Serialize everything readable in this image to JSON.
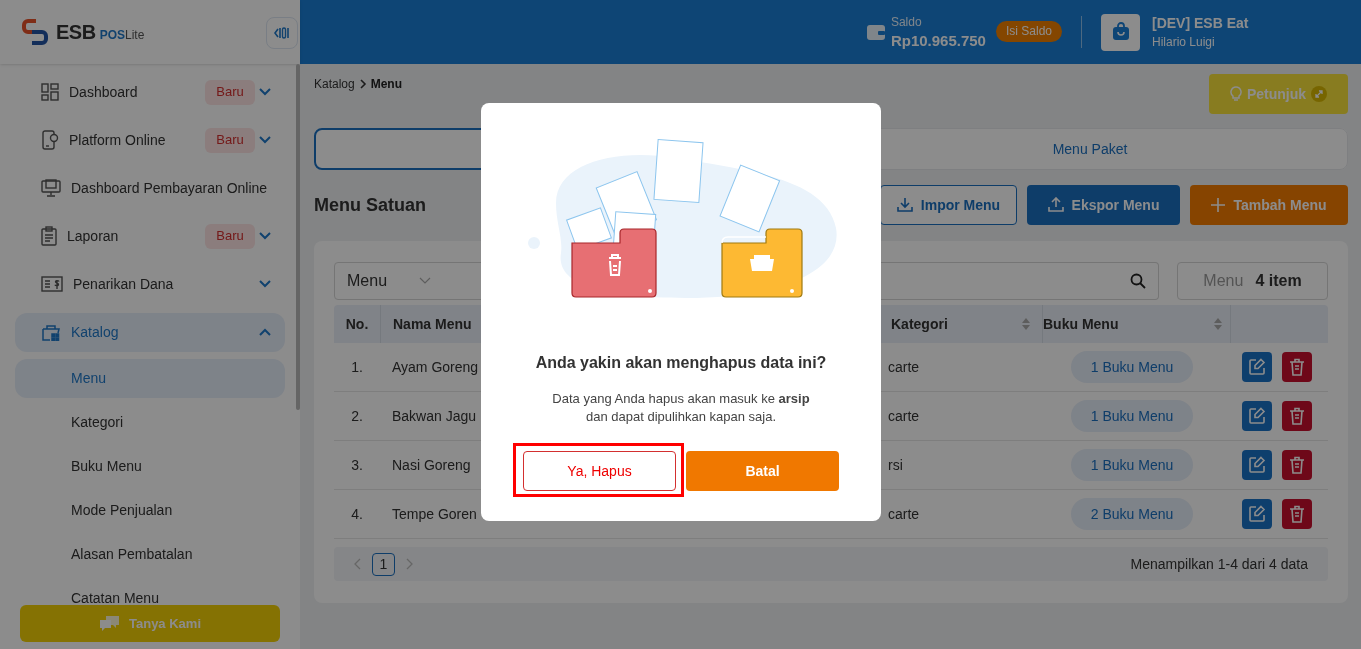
{
  "sidebar": {
    "logo": {
      "brand": "ESB",
      "product": "POS",
      "edition": "Lite"
    },
    "items": [
      {
        "label": "Dashboard",
        "badge": "Baru",
        "expandable": true,
        "expanded": false,
        "selected": false
      },
      {
        "label": "Platform Online",
        "badge": "Baru",
        "expandable": true,
        "expanded": false,
        "selected": false
      },
      {
        "label": "Dashboard Pembayaran Online",
        "expandable": false,
        "selected": false
      },
      {
        "label": "Laporan",
        "badge": "Baru",
        "expandable": true,
        "expanded": false,
        "selected": false
      },
      {
        "label": "Penarikan Dana",
        "expandable": true,
        "expanded": false,
        "selected": false
      },
      {
        "label": "Katalog",
        "expandable": true,
        "expanded": true,
        "selected": true,
        "children": [
          {
            "label": "Menu",
            "selected": true
          },
          {
            "label": "Kategori",
            "selected": false
          },
          {
            "label": "Buku Menu",
            "selected": false
          },
          {
            "label": "Mode Penjualan",
            "selected": false
          },
          {
            "label": "Alasan Pembatalan",
            "selected": false
          },
          {
            "label": "Catatan Menu",
            "selected": false
          }
        ]
      }
    ],
    "help_button": "Tanya Kami"
  },
  "header": {
    "balance_label": "Saldo",
    "balance": "Rp10.965.750",
    "top_up": "Isi Saldo",
    "store": "[DEV] ESB Eat",
    "user": "Hilario Luigi"
  },
  "breadcrumb": [
    "Katalog",
    "Menu"
  ],
  "guide_button": "Petunjuk",
  "tabs": [
    {
      "selected": true
    },
    {
      "label": "Menu Paket",
      "selected": false
    }
  ],
  "section_title": "Menu Satuan",
  "actions": [
    {
      "kind": "outline",
      "label": "Impor Menu"
    },
    {
      "kind": "primary",
      "label": "Ekspor Menu"
    },
    {
      "kind": "accent",
      "label": "Tambah Menu"
    }
  ],
  "filter": {
    "value": "Menu"
  },
  "count": {
    "label": "Menu",
    "value": "4 item"
  },
  "table": {
    "columns": [
      {
        "label": "No.",
        "sortable": false
      },
      {
        "label": "Nama Menu",
        "sortable": false
      },
      {
        "label": "Kategori",
        "sortable": true
      },
      {
        "label": "Buku Menu",
        "sortable": true
      }
    ],
    "rows": [
      {
        "no": "1.",
        "name": "Ayam Goreng",
        "category": "carte",
        "books": "1 Buku Menu"
      },
      {
        "no": "2.",
        "name": "Bakwan Jagu",
        "category": "carte",
        "books": "1 Buku Menu"
      },
      {
        "no": "3.",
        "name": "Nasi Goreng",
        "category": "rsi",
        "books": "1 Buku Menu"
      },
      {
        "no": "4.",
        "name": "Tempe Goren",
        "category": "carte",
        "books": "2 Buku Menu"
      }
    ]
  },
  "pagination": {
    "page": "1",
    "summary": "Menampilkan 1-4 dari 4 data"
  },
  "modal": {
    "title": "Anda yakin akan menghapus data ini?",
    "message": "Data yang Anda hapus akan masuk ke **arsip** dan dapat dipulihkan kapan saja.",
    "confirm": "Ya, Hapus",
    "cancel": "Batal"
  },
  "annotation": {
    "kind": "frame"
  }
}
